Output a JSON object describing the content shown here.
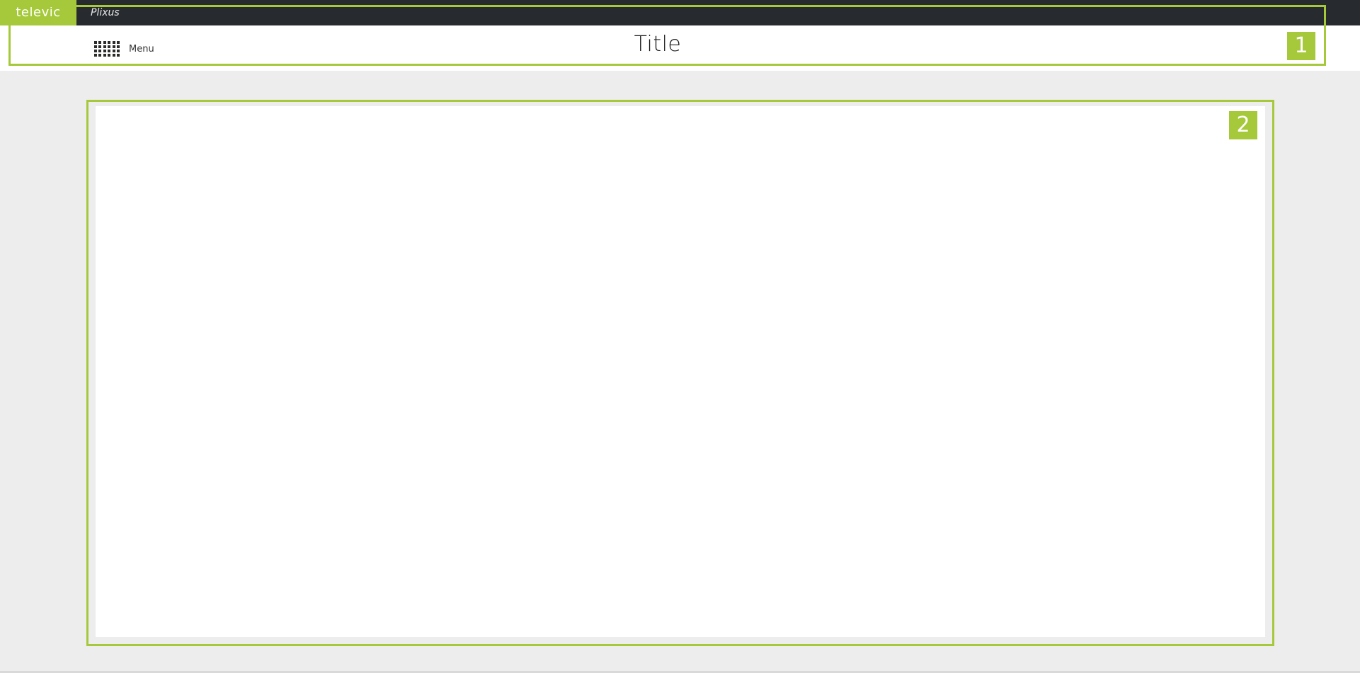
{
  "brand": {
    "logo_text": "televic",
    "app_name": "Plixus"
  },
  "header": {
    "menu_label": "Menu",
    "title": "Title"
  },
  "annotations": {
    "header_marker": "1",
    "content_marker": "2"
  },
  "colors": {
    "accent": "#a5c93a",
    "topbar": "#272a2e",
    "background": "#ededed"
  },
  "icons": {
    "menu": "grid-icon"
  }
}
